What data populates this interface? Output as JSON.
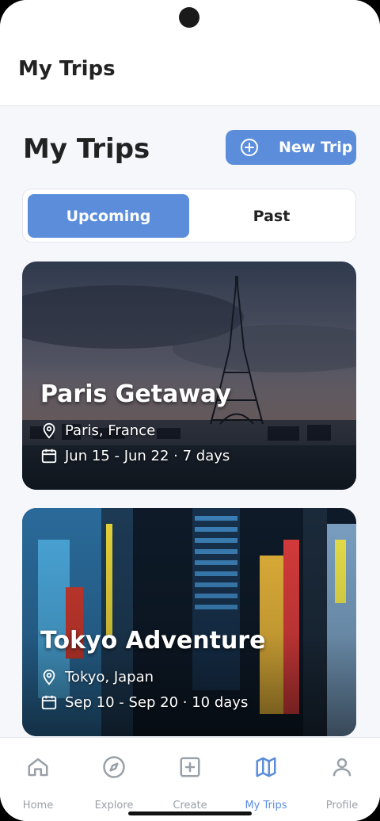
{
  "appbar": {
    "title": "My Trips"
  },
  "page": {
    "title": "My Trips"
  },
  "actions": {
    "new_trip": "New Trip"
  },
  "tabs": [
    {
      "label": "Upcoming",
      "active": true
    },
    {
      "label": "Past",
      "active": false
    }
  ],
  "trips": [
    {
      "title": "Paris Getaway",
      "location": "Paris, France",
      "dates": "Jun 15 - Jun 22 · 7 days"
    },
    {
      "title": "Tokyo Adventure",
      "location": "Tokyo, Japan",
      "dates": "Sep 10 - Sep 20 · 10 days"
    }
  ],
  "nav": [
    {
      "label": "Home",
      "icon": "home-icon"
    },
    {
      "label": "Explore",
      "icon": "compass-icon"
    },
    {
      "label": "Create",
      "icon": "plus-square-icon"
    },
    {
      "label": "My Trips",
      "icon": "map-icon",
      "active": true
    },
    {
      "label": "Profile",
      "icon": "user-icon"
    }
  ],
  "colors": {
    "accent": "#5b8ddb",
    "background": "#f5f7fb"
  }
}
